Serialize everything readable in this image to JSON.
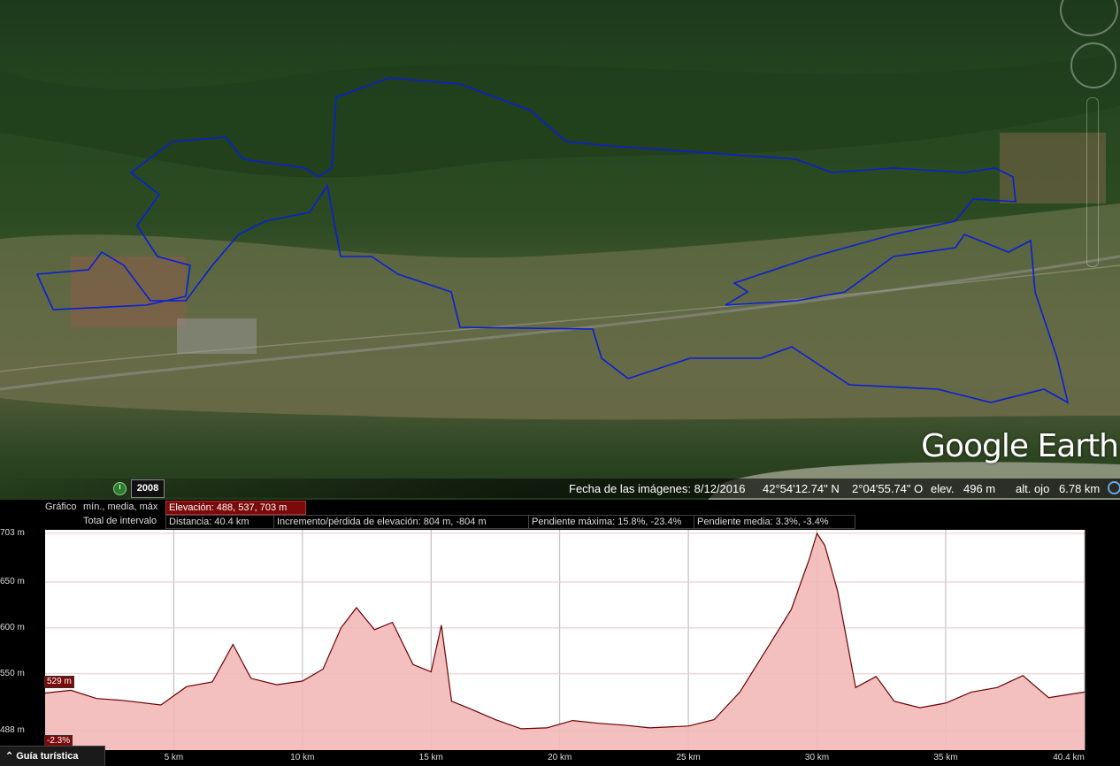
{
  "map": {
    "logo_text": "Google Earth",
    "year": "2008",
    "image_date": "Fecha de las imágenes: 8/12/2016",
    "lat": "42°54'12.74\" N",
    "lon": "2°04'55.74\" O",
    "elev_label": "elev.",
    "elev_value": "496 m",
    "eye_label": "alt. ojo",
    "eye_value": "6.78 km",
    "track_color": "#0a1fd6",
    "icons": [
      "clock-icon",
      "globe-icon",
      "compass-ring",
      "zoom-slider"
    ]
  },
  "profile": {
    "graph_label": "Gráfico",
    "graph_mode": "mín., media, máx",
    "interval_label": "Total de intervalo",
    "elevation_stat": "Elevación: 488, 537, 703 m",
    "distance_stat": "Distancia: 40.4 km",
    "gain_stat": "Incremento/pérdida de elevación: 804 m, -804 m",
    "max_slope_stat": "Pendiente máxima: 15.8%, -23.4%",
    "avg_slope_stat": "Pendiente media: 3.3%, -3.4%",
    "cursor_elev": "529 m",
    "cursor_slope": "-2.3%",
    "tour_button": "Guía turística",
    "accent": "#7b0a0a",
    "fill_color": "#f3b8b8",
    "line_color": "#6b0000"
  },
  "chart_data": {
    "type": "area",
    "xlabel": "",
    "ylabel": "",
    "xlim": [
      0,
      40.4
    ],
    "ylim": [
      488,
      703
    ],
    "y_ticks": [
      "703 m",
      "650 m",
      "600 m",
      "550 m",
      "488 m"
    ],
    "y_tick_values": [
      703,
      650,
      600,
      550,
      488
    ],
    "x_ticks": [
      "5 km",
      "10 km",
      "15 km",
      "20 km",
      "25 km",
      "30 km",
      "35 km",
      "40.4 km"
    ],
    "x_tick_values": [
      5,
      10,
      15,
      20,
      25,
      30,
      35,
      40.4
    ],
    "grid": true,
    "series": [
      {
        "x": [
          0,
          1,
          2,
          3,
          4.5,
          5.5,
          6.5,
          7.3,
          8,
          9,
          10,
          10.8,
          11.5,
          12.1,
          12.8,
          13.5,
          14.3,
          15,
          15.4,
          15.8,
          16.5,
          17.5,
          18.5,
          19.5,
          20.5,
          21.5,
          22.5,
          23.5,
          25,
          26,
          27,
          28,
          29,
          29.7,
          30,
          30.3,
          30.8,
          31.5,
          32.3,
          33,
          34,
          35,
          36,
          37,
          38,
          39,
          40.4
        ],
        "y": [
          529,
          532,
          523,
          521,
          516,
          536,
          541,
          582,
          545,
          538,
          542,
          555,
          600,
          622,
          598,
          606,
          560,
          552,
          603,
          520,
          512,
          500,
          490,
          491,
          499,
          496,
          494,
          491,
          493,
          500,
          530,
          575,
          620,
          675,
          703,
          690,
          640,
          535,
          547,
          520,
          513,
          518,
          530,
          535,
          548,
          524,
          530
        ]
      }
    ]
  }
}
